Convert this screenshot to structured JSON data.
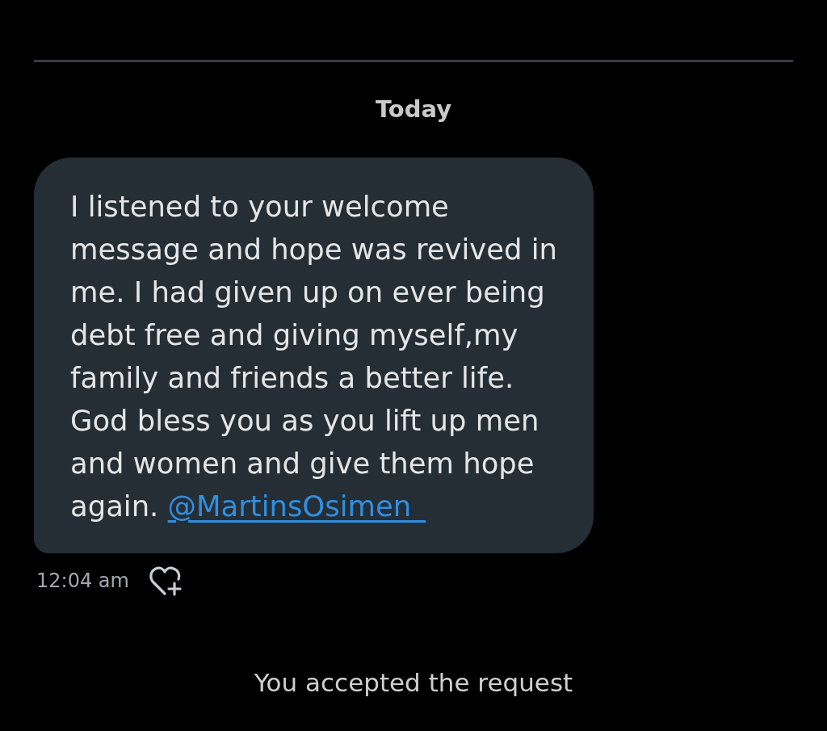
{
  "date_separator": "Today",
  "message": {
    "text": "I listened to your welcome message and hope was revived in me. I had given up on ever being debt free and giving myself,my family and friends a better life. God bless you as you lift up men and women and give them hope again.",
    "mention": "@MartinsOsimen_",
    "timestamp": "12:04 am"
  },
  "system_notice": "You accepted the request"
}
